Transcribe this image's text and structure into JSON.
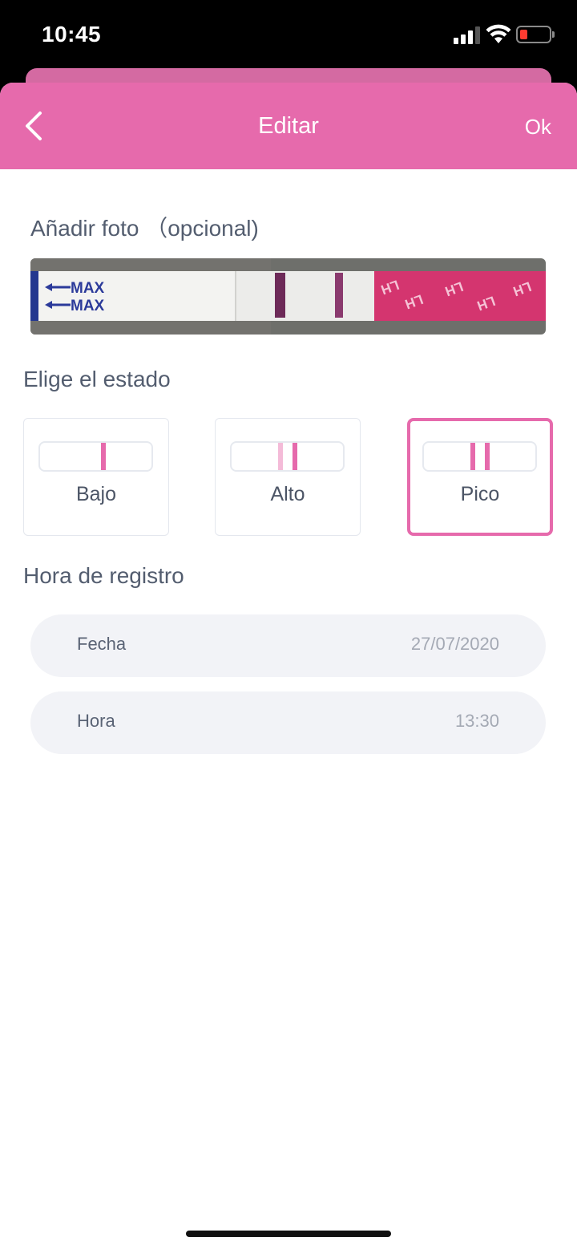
{
  "status_bar": {
    "time": "10:45"
  },
  "nav": {
    "title": "Editar",
    "ok_label": "Ok"
  },
  "photo_section": {
    "title": "Añadir foto （opcional)",
    "strip_text": "MAX",
    "strip_brand": "LH"
  },
  "state_section": {
    "title": "Elige el estado",
    "options": [
      {
        "label": "Bajo",
        "selected": false
      },
      {
        "label": "Alto",
        "selected": false
      },
      {
        "label": "Pico",
        "selected": true
      }
    ]
  },
  "time_section": {
    "title": "Hora de registro",
    "fields": [
      {
        "label": "Fecha",
        "value": "27/07/2020"
      },
      {
        "label": "Hora",
        "value": "13:30"
      }
    ]
  },
  "colors": {
    "accent": "#e66aac",
    "accent_light": "#f4bbd8",
    "text": "#535d6f",
    "field_bg": "#f2f3f7"
  }
}
